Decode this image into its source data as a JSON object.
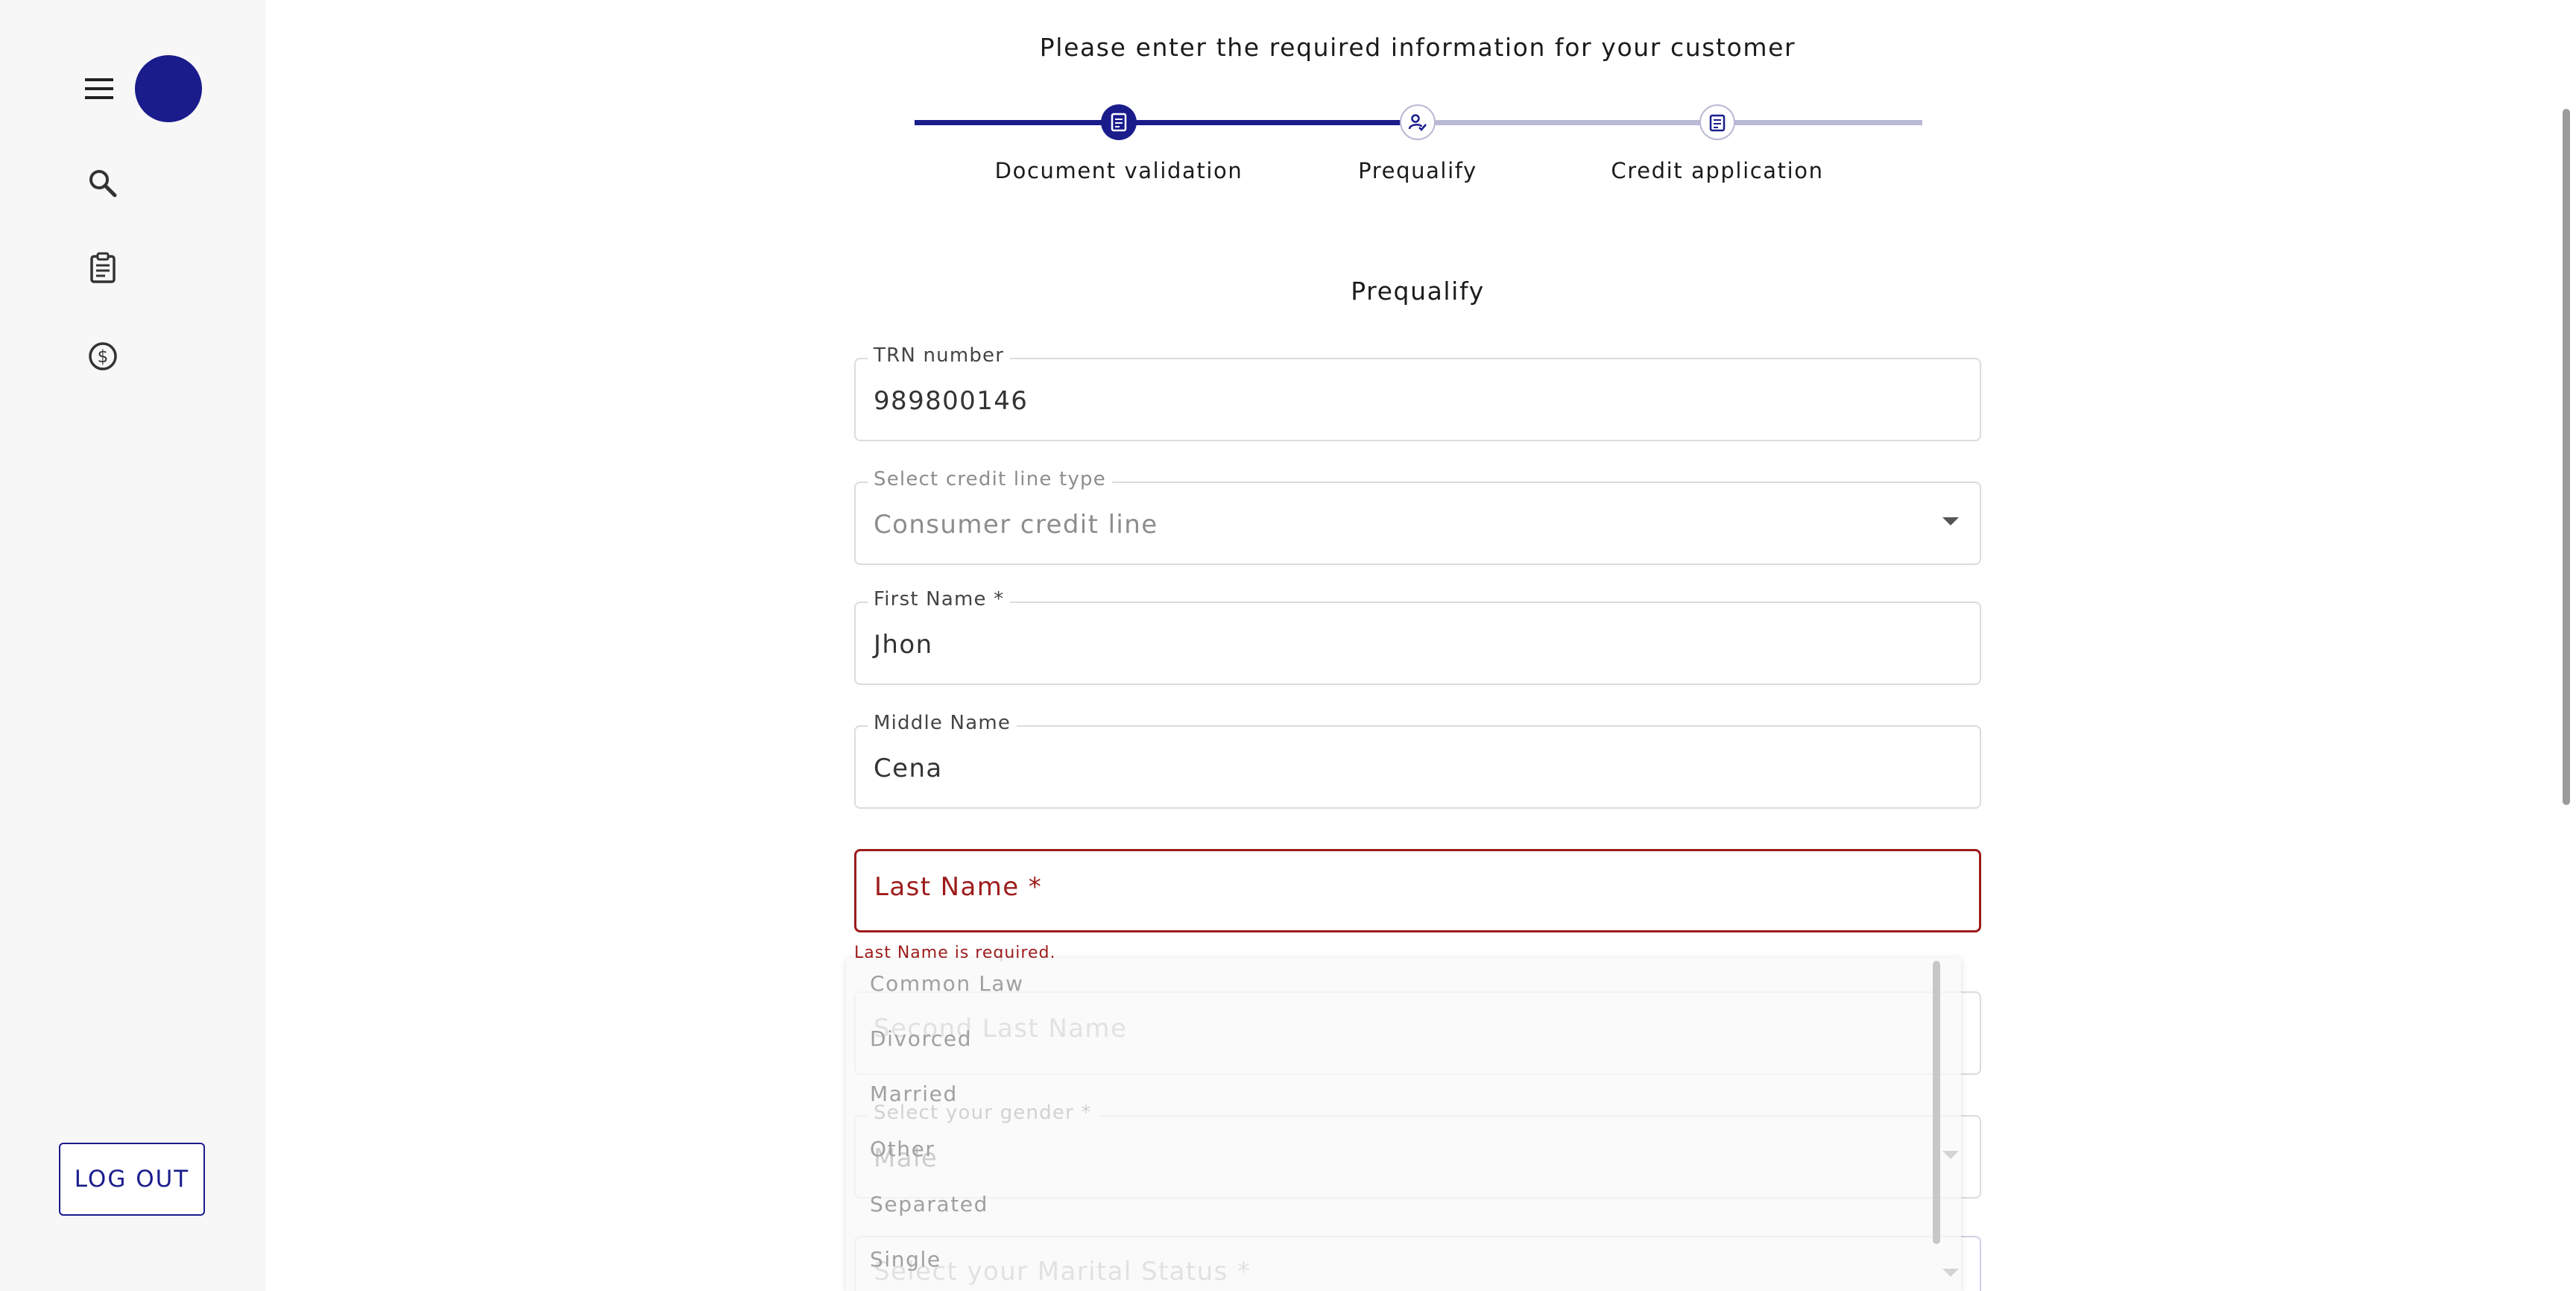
{
  "header": {
    "title": "Please enter the required information for your customer"
  },
  "stepper": {
    "steps": [
      {
        "label": "Document validation",
        "icon": "document-check-icon",
        "state": "completed"
      },
      {
        "label": "Prequalify",
        "icon": "person-check-icon",
        "state": "active"
      },
      {
        "label": "Credit application",
        "icon": "clipboard-icon",
        "state": "upcoming"
      }
    ]
  },
  "sidebar": {
    "items": [
      {
        "name": "search",
        "icon": "search-icon"
      },
      {
        "name": "applications",
        "icon": "clipboard-icon"
      },
      {
        "name": "credits",
        "icon": "dollar-circle-icon"
      }
    ],
    "logout_label": "LOG OUT"
  },
  "form": {
    "title": "Prequalify",
    "trn": {
      "label": "TRN number",
      "value": "989800146"
    },
    "credit_line": {
      "label": "Select credit line type",
      "value": "Consumer credit line"
    },
    "first_name": {
      "label": "First Name *",
      "value": "Jhon"
    },
    "middle_name": {
      "label": "Middle Name",
      "value": "Cena"
    },
    "last_name": {
      "placeholder": "Last Name *",
      "error": "Last Name is required."
    },
    "second_last_name": {
      "placeholder": "Second Last Name"
    },
    "gender": {
      "label": "Select your gender *",
      "value": "Male"
    },
    "marital_status": {
      "placeholder": "Select your Marital Status *"
    }
  },
  "marital_options": [
    "Common Law",
    "Divorced",
    "Married",
    "Other",
    "Separated",
    "Single"
  ],
  "colors": {
    "primary": "#1a1c8c",
    "error": "#9e1b1b",
    "inactive_line": "#b9b9d6"
  }
}
